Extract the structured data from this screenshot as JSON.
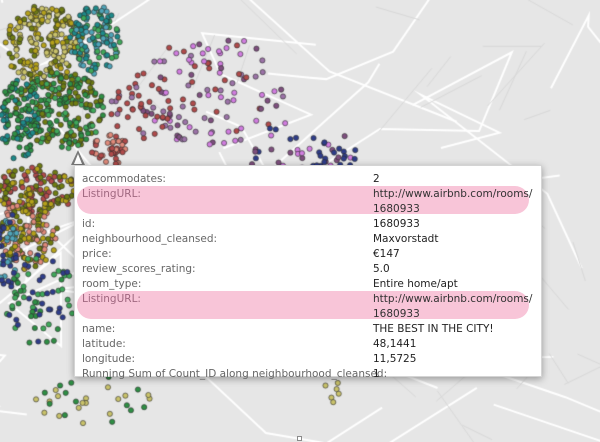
{
  "map": {
    "background_color": "#e6e6e6",
    "road_color": "#ffffff",
    "water_color": "#cfd6de",
    "marker_colors": [
      "#b5a21a",
      "#6f7d12",
      "#2e8f44",
      "#3fa85a",
      "#1d8a8a",
      "#4fa4b8",
      "#b04a4a",
      "#e08a7a",
      "#7f4f7f",
      "#9c73a8",
      "#2f3d8a",
      "#d17de0",
      "#c9c26a"
    ]
  },
  "tooltip": {
    "highlight_color": "#f8c5d8",
    "rows": [
      {
        "label": "accommodates:",
        "value": "2",
        "highlight": false
      },
      {
        "label": "ListingURL:",
        "value": "http://www.airbnb.com/rooms/ 1680933",
        "highlight": true
      },
      {
        "label": "id:",
        "value": "1680933",
        "highlight": false
      },
      {
        "label": "neighbourhood_cleansed:",
        "value": "Maxvorstadt",
        "highlight": false
      },
      {
        "label": "price:",
        "value": "€147",
        "highlight": false
      },
      {
        "label": "review_scores_rating:",
        "value": "5.0",
        "highlight": false
      },
      {
        "label": "room_type:",
        "value": "Entire home/apt",
        "highlight": false
      },
      {
        "label": "ListingURL:",
        "value": "http://www.airbnb.com/rooms/ 1680933",
        "highlight": true
      },
      {
        "label": "name:",
        "value": "THE BEST IN THE CITY!",
        "highlight": false
      },
      {
        "label": "latitude:",
        "value": "48,1441",
        "highlight": false
      },
      {
        "label": "longitude:",
        "value": "11,5725",
        "highlight": false
      },
      {
        "label": "Running Sum of Count_ID along neighbourhood_cleansed:",
        "value": "1",
        "highlight": false
      }
    ]
  }
}
